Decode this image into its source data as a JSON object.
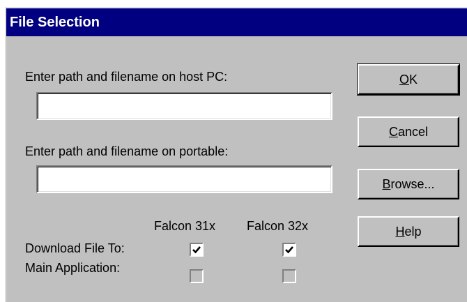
{
  "window": {
    "title": "File Selection"
  },
  "fields": {
    "host_label": "Enter path and filename on host PC:",
    "host_value": "",
    "portable_label": "Enter path and filename on portable:",
    "portable_value": ""
  },
  "buttons": {
    "ok": {
      "accel": "O",
      "rest": "K"
    },
    "cancel": {
      "accel": "C",
      "rest": "ancel"
    },
    "browse": {
      "accel": "B",
      "rest": "rowse..."
    },
    "help": {
      "accel": "H",
      "rest": "elp"
    }
  },
  "options": {
    "col_31x": "Falcon 31x",
    "col_32x": "Falcon 32x",
    "download_label": "Download File To:",
    "main_app_label": "Main Application:",
    "download_31x_checked": true,
    "download_32x_checked": true,
    "main_app_31x_checked": false,
    "main_app_32x_checked": false
  },
  "colors": {
    "titlebar": "#000080",
    "face": "#c0c0c0"
  }
}
